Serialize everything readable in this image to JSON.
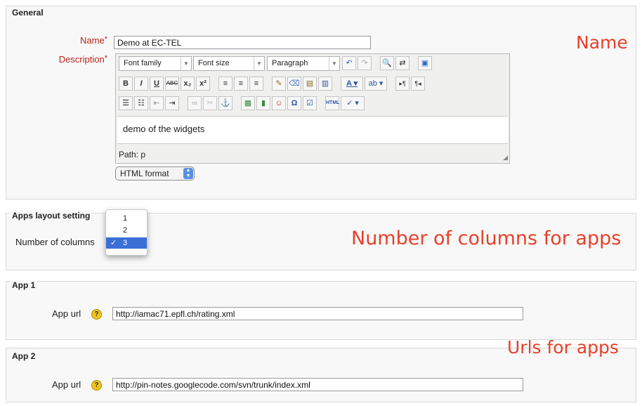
{
  "sections": {
    "general": "General",
    "apps_layout": "Apps layout setting",
    "app1": "App 1",
    "app2": "App 2"
  },
  "general": {
    "name_label": "Name",
    "name_value": "Demo at EC-TEL",
    "description_label": "Description",
    "required_mark": "*",
    "editor": {
      "font_family": "Font family",
      "font_size": "Font size",
      "format_block": "Paragraph",
      "content": "demo of the widgets",
      "path": "Path: p"
    },
    "text_format": "HTML format"
  },
  "apps_layout": {
    "columns_label": "Number of columns",
    "options": [
      "1",
      "2",
      "3"
    ],
    "selected": "3"
  },
  "app1": {
    "url_label": "App url",
    "url_value": "http://iamac71.epfl.ch/rating.xml",
    "help": "?"
  },
  "app2": {
    "url_label": "App url",
    "url_value": "http://pin-notes.googlecode.com/svn/trunk/index.xml",
    "help": "?"
  },
  "annotations": {
    "name": "Name",
    "columns": "Number of columns for apps",
    "urls": "Urls for apps"
  },
  "colors": {
    "annotation": "#e8402a",
    "required": "#b8221a",
    "selection": "#3b6fd8"
  },
  "icons": [
    "undo-icon",
    "redo-icon",
    "find-icon",
    "replace-icon",
    "fullscreen-icon",
    "bold-icon",
    "italic-icon",
    "underline-icon",
    "strikethrough-icon",
    "subscript-icon",
    "superscript-icon",
    "align-left-icon",
    "align-center-icon",
    "align-right-icon",
    "cleanup-icon",
    "eraser-icon",
    "paste-text-icon",
    "paste-word-icon",
    "text-color-icon",
    "highlight-icon",
    "ltr-icon",
    "rtl-icon",
    "bullet-list-icon",
    "numbered-list-icon",
    "outdent-icon",
    "indent-icon",
    "link-icon",
    "unlink-icon",
    "anchor-icon",
    "image-icon",
    "media-icon",
    "emoticon-icon",
    "special-char-icon",
    "form-icon",
    "html-icon",
    "spellcheck-icon"
  ]
}
